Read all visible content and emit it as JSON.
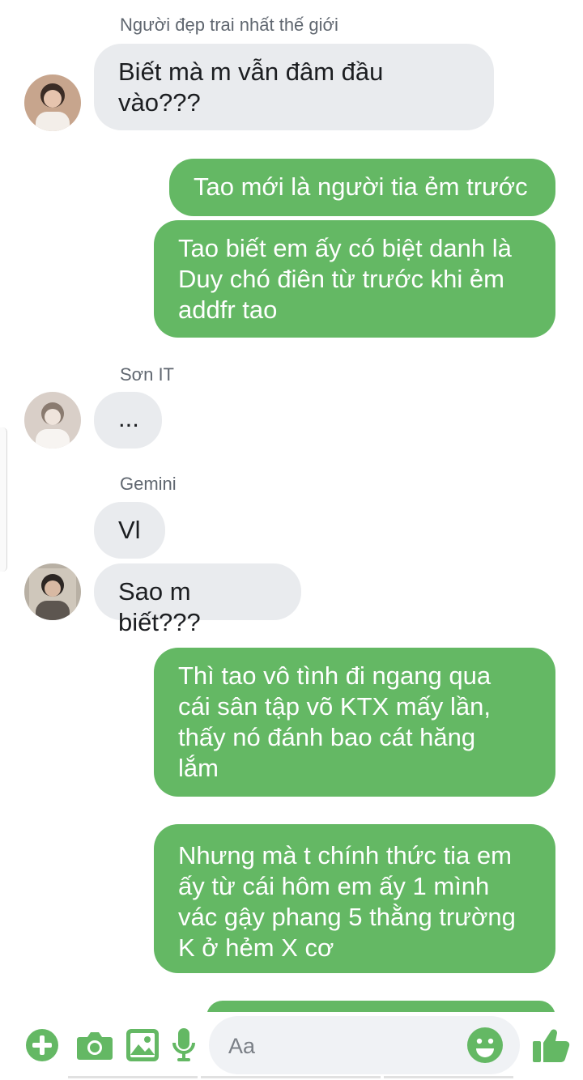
{
  "colors": {
    "accent": "#64b864",
    "incoming_bubble": "#e9ebee",
    "incoming_text": "#1c1e21",
    "outgoing_text": "#ffffff",
    "sender_name": "#606770"
  },
  "messages": [
    {
      "sender": "Người đẹp trai nhất thế giới",
      "direction": "incoming",
      "lines": [
        "Biết mà m vẫn đâm đầu",
        "vào???"
      ]
    },
    {
      "direction": "outgoing",
      "lines": [
        "Tao mới là người tia ẻm trước"
      ]
    },
    {
      "direction": "outgoing",
      "lines": [
        "Tao biết em ấy có biệt danh là",
        "Duy chó điên từ trước khi ẻm",
        "addfr tao"
      ]
    },
    {
      "sender": "Sơn IT",
      "direction": "incoming",
      "lines": [
        "..."
      ]
    },
    {
      "sender": "Gemini",
      "direction": "incoming",
      "lines": [
        "Vl"
      ]
    },
    {
      "direction": "incoming",
      "lines": [
        "Sao m biết???"
      ]
    },
    {
      "direction": "outgoing",
      "lines": [
        "Thì tao vô tình đi ngang qua",
        "cái sân tập võ KTX mấy lần,",
        "thấy nó đánh bao cát hăng",
        "lắm"
      ]
    },
    {
      "direction": "outgoing",
      "lines": [
        "Nhưng mà t chính thức tia em",
        "ấy từ cái hôm em ấy 1 mình",
        "vác gậy phang 5 thằng trường",
        "K ở hẻm X cơ"
      ]
    }
  ],
  "composer": {
    "placeholder": "Aa",
    "icons": [
      "add-icon",
      "camera-icon",
      "gallery-icon",
      "microphone-icon",
      "emoji-icon",
      "thumbs-up-icon"
    ]
  }
}
